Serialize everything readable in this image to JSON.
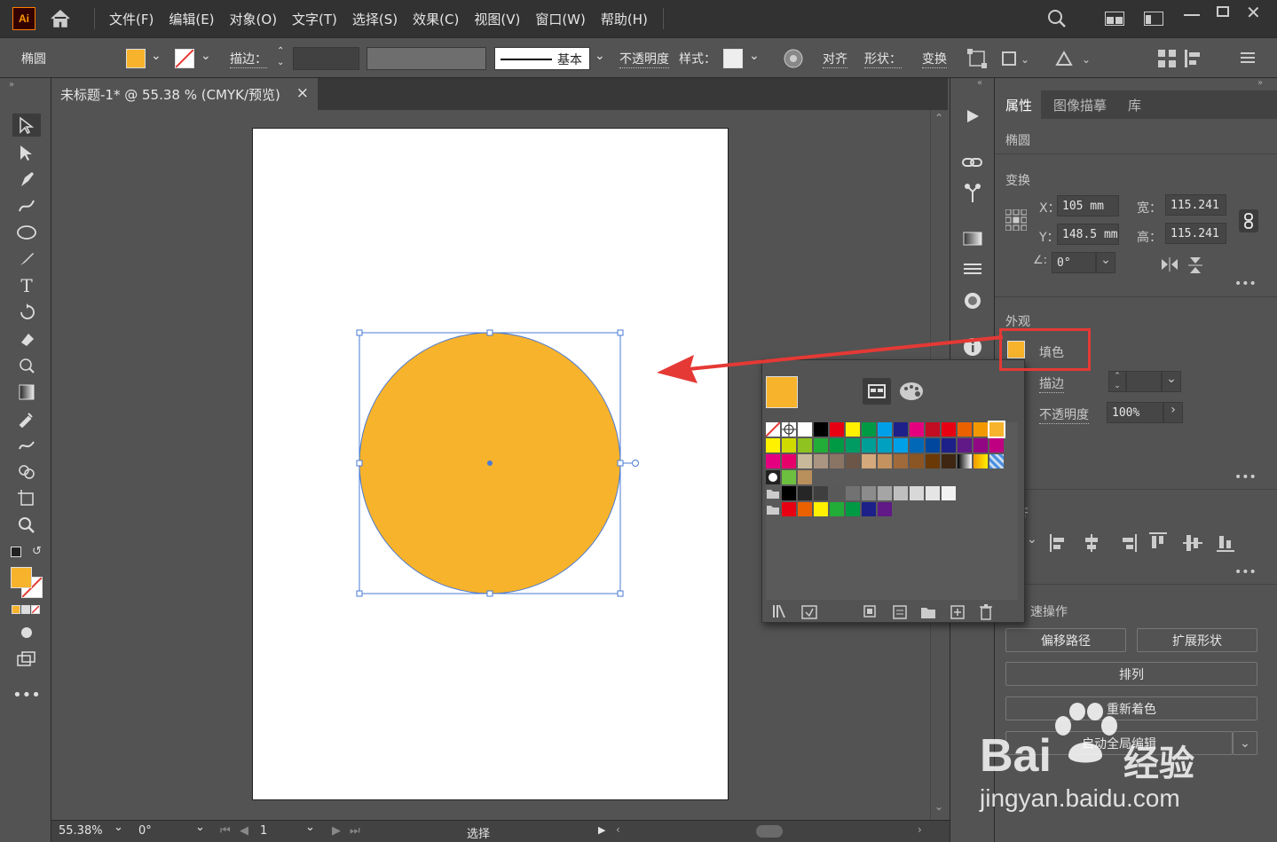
{
  "app": {
    "logo": "Ai"
  },
  "menu": [
    "文件(F)",
    "编辑(E)",
    "对象(O)",
    "文字(T)",
    "选择(S)",
    "效果(C)",
    "视图(V)",
    "窗口(W)",
    "帮助(H)"
  ],
  "control_bar": {
    "object_type": "椭圆",
    "stroke_label": "描边：",
    "stroke_profile": "基本",
    "opacity_label": "不透明度",
    "style_label": "样式：",
    "align_label": "对齐",
    "shape_label": "形状：",
    "transform_label": "变换",
    "fill_color": "#f7b32b"
  },
  "document_tab": {
    "title": "未标题-1* @ 55.38 % (CMYK/预览)",
    "close": "×"
  },
  "properties": {
    "tabs": [
      "属性",
      "图像描摹",
      "库"
    ],
    "object": "椭圆",
    "transform": {
      "title": "变换",
      "x_label": "X：",
      "x": "105 mm",
      "y_label": "Y：",
      "y": "148.5 mm",
      "w_label": "宽：",
      "w": "115.241",
      "h_label": "高：",
      "h": "115.241",
      "angle": "0°"
    },
    "appearance": {
      "title": "外观",
      "fill_label": "填色",
      "stroke_label": "描边",
      "opacity_label": "不透明度",
      "opacity": "100%"
    },
    "align_title_partial": "齐",
    "quick_actions": {
      "title_partial": "速操作",
      "offset_path": "偏移路径",
      "expand_shape": "扩展形状",
      "arrange": "排列",
      "recolor": "重新着色",
      "global_edit": "启动全局编辑"
    }
  },
  "status_bar": {
    "zoom": "55.38%",
    "rotation": "0°",
    "page": "1",
    "tool": "选择"
  },
  "watermark": {
    "brand": "Bai",
    "brand2": "经验",
    "url": "jingyan.baidu.com"
  },
  "colors": {
    "fill": "#f7b32b",
    "selection": "#4a7bd6",
    "highlight": "#e53935"
  }
}
